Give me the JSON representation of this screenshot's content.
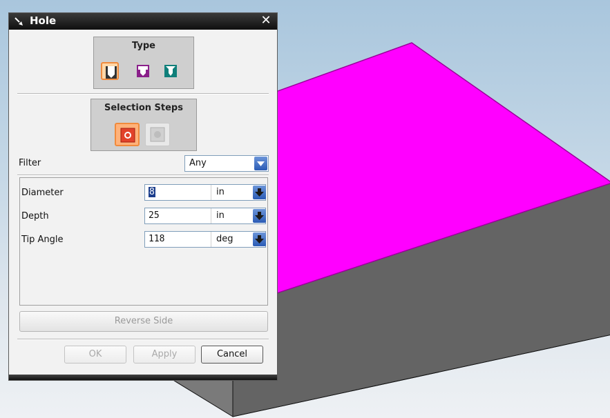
{
  "dialog": {
    "title": "Hole",
    "type_group": {
      "label": "Type",
      "options": [
        "simple-hole-icon",
        "counterbore-hole-icon",
        "countersink-hole-icon"
      ],
      "selected_index": 0
    },
    "selection_steps": {
      "label": "Selection Steps",
      "steps": [
        "placement-face-icon",
        "thru-face-icon"
      ],
      "active_index": 0
    },
    "filter": {
      "label": "Filter",
      "value": "Any"
    },
    "parameters": [
      {
        "label": "Diameter",
        "value": "8",
        "unit": "in"
      },
      {
        "label": "Depth",
        "value": "25",
        "unit": "in"
      },
      {
        "label": "Tip Angle",
        "value": "118",
        "unit": "deg"
      }
    ],
    "reverse_side_label": "Reverse Side",
    "buttons": {
      "ok": "OK",
      "apply": "Apply",
      "cancel": "Cancel"
    }
  },
  "colors": {
    "top_face": "#ff00ff",
    "side_face": "#7a7a7a",
    "accent": "#f08a3c"
  }
}
